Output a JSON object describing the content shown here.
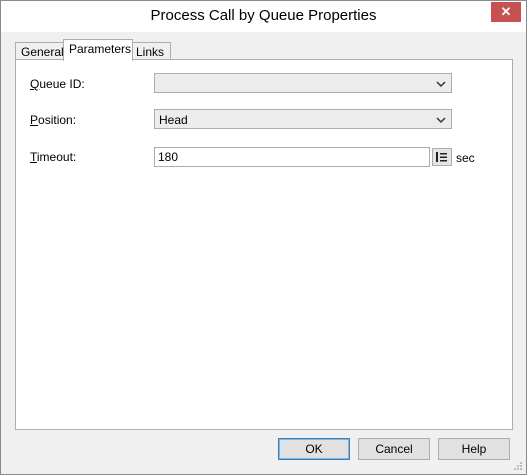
{
  "window": {
    "title": "Process Call by Queue Properties",
    "close_glyph": "✕"
  },
  "tabs": [
    {
      "label": "General",
      "active": false
    },
    {
      "label": "Parameters",
      "active": true
    },
    {
      "label": "Links",
      "active": false
    }
  ],
  "fields": {
    "queue_id": {
      "label_access": "Q",
      "label_rest": "ueue ID:",
      "value": ""
    },
    "position": {
      "label_access": "P",
      "label_rest": "osition:",
      "value": "Head"
    },
    "timeout": {
      "label_access": "T",
      "label_rest": "imeout:",
      "value": "180",
      "unit": "sec"
    }
  },
  "buttons": {
    "ok": "OK",
    "cancel": "Cancel",
    "help": "Help"
  },
  "icons": {
    "dropdown": "chevron-down-icon",
    "spin": "number-picker-icon",
    "grip": "resize-grip-icon"
  }
}
